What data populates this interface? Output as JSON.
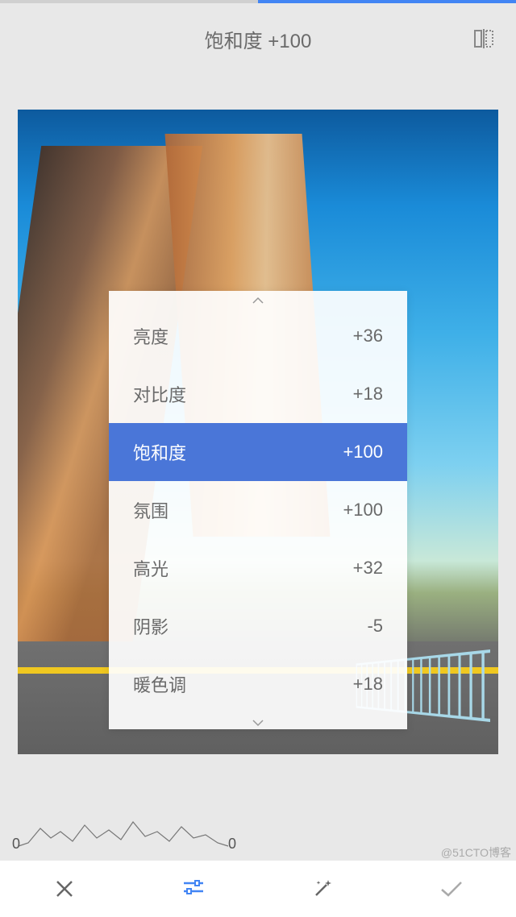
{
  "header": {
    "title": "饱和度 +100",
    "progress_percent": 100
  },
  "adjustments": [
    {
      "label": "亮度",
      "value": "+36",
      "selected": false
    },
    {
      "label": "对比度",
      "value": "+18",
      "selected": false
    },
    {
      "label": "饱和度",
      "value": "+100",
      "selected": true
    },
    {
      "label": "氛围",
      "value": "+100",
      "selected": false
    },
    {
      "label": "高光",
      "value": "+32",
      "selected": false
    },
    {
      "label": "阴影",
      "value": "-5",
      "selected": false
    },
    {
      "label": "暖色调",
      "value": "+18",
      "selected": false
    }
  ],
  "histogram": {
    "left_label": "0",
    "right_label": "0"
  },
  "toolbar": {
    "cancel": "cancel",
    "adjust": "adjust",
    "magic": "magic",
    "confirm": "confirm"
  },
  "watermark": "@51CTO博客",
  "colors": {
    "accent": "#4a76d8",
    "progress": "#4285f4"
  }
}
